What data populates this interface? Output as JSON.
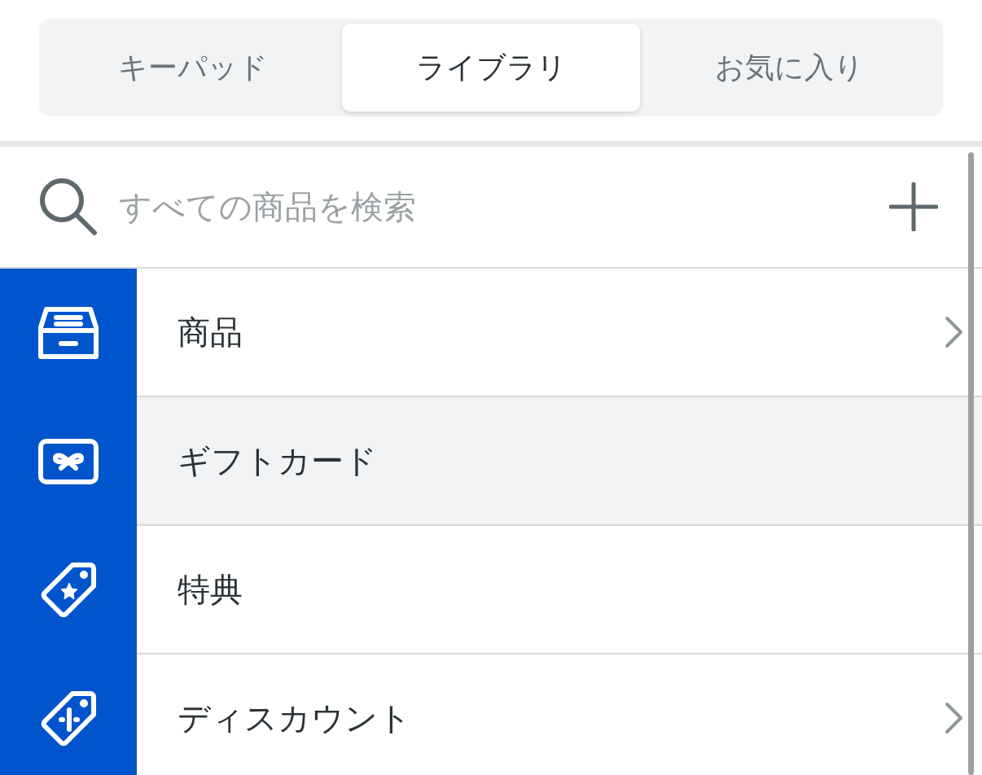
{
  "tabs": [
    {
      "label": "キーパッド",
      "selected": false
    },
    {
      "label": "ライブラリ",
      "selected": true
    },
    {
      "label": "お気に入り",
      "selected": false
    }
  ],
  "search": {
    "placeholder": "すべての商品を検索"
  },
  "items": [
    {
      "label": "商品",
      "selected": false,
      "chevron": true
    },
    {
      "label": "ギフトカード",
      "selected": true,
      "chevron": false
    },
    {
      "label": "特典",
      "selected": false,
      "chevron": false
    },
    {
      "label": "ディスカウント",
      "selected": false,
      "chevron": true
    }
  ]
}
